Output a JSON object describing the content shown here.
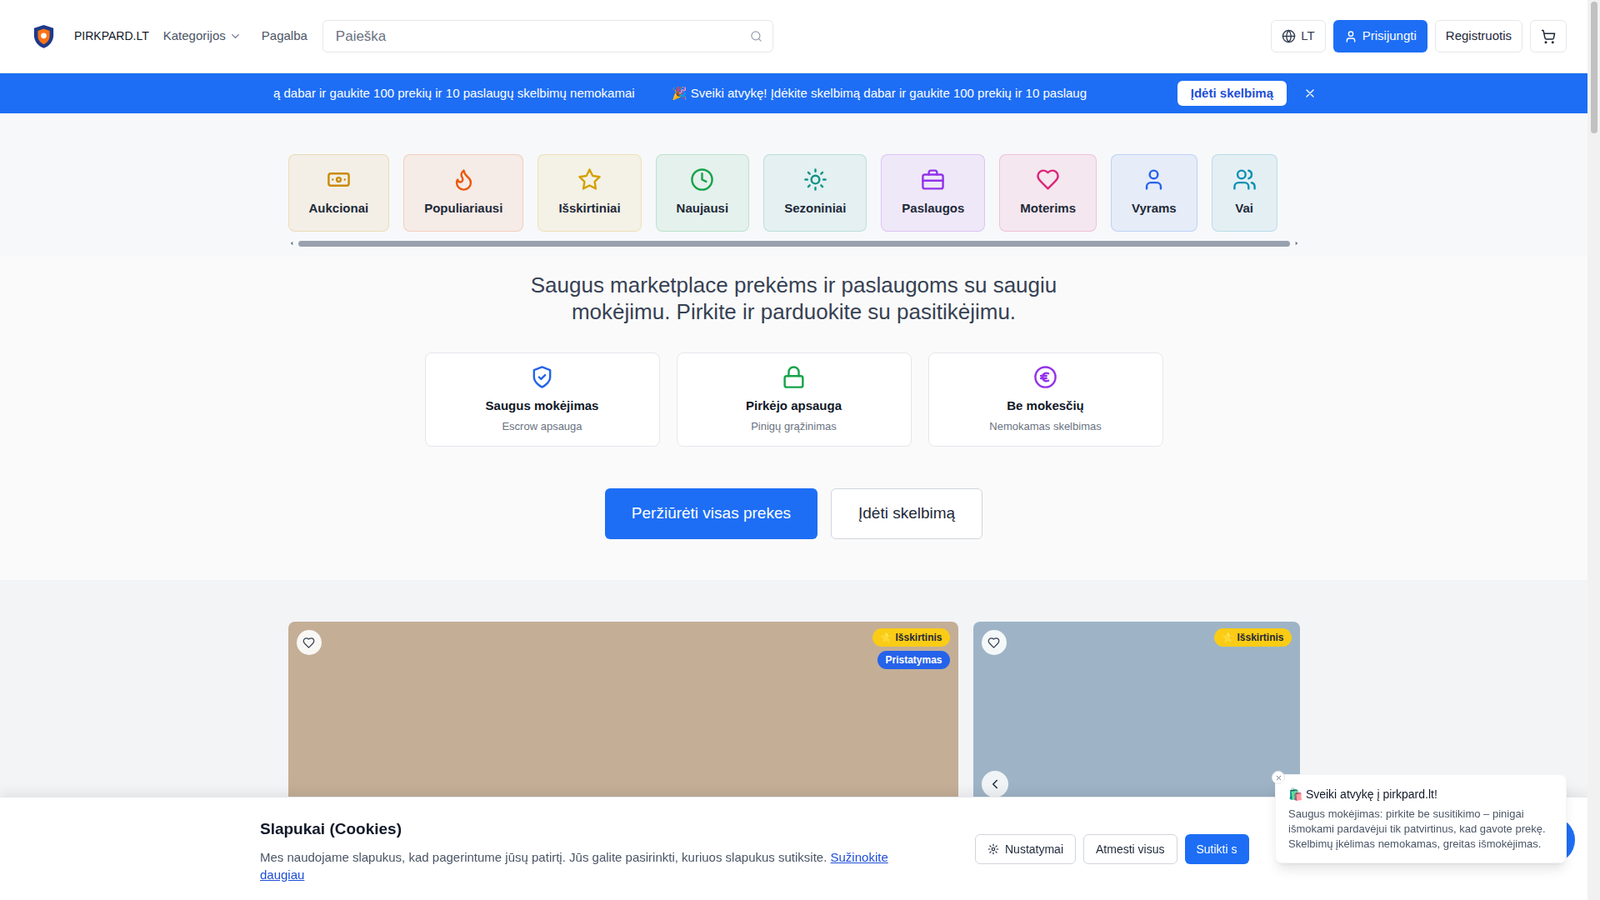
{
  "header": {
    "brand": "PIRKPARD.LT",
    "nav": [
      {
        "label": "Kategorijos",
        "kind": "dropdown",
        "expanded": false
      },
      {
        "label": "Pagalba",
        "kind": "link",
        "expanded": false
      }
    ],
    "search": {
      "placeholder": "Paieška"
    },
    "language": "LT",
    "login": "Prisijungti",
    "register": "Registruotis"
  },
  "banner": {
    "messages": [
      "ą dabar ir gaukite 100 prekių ir 10 paslaugų skelbimų nemokamai",
      "🎉 Sveiki atvykę! Įdėkite skelbimą dabar ir gaukite 100 prekių ir 10 paslaug"
    ],
    "cta": "Įdėti skelbimą"
  },
  "categories": [
    {
      "label": "Aukcionai",
      "color": "#ca8a04"
    },
    {
      "label": "Populiariausi",
      "color": "#ea580c"
    },
    {
      "label": "Išskirtiniai",
      "color": "#d4a106"
    },
    {
      "label": "Naujausi",
      "color": "#16a34a"
    },
    {
      "label": "Sezoniniai",
      "color": "#0d9488"
    },
    {
      "label": "Paslaugos",
      "color": "#9333ea"
    },
    {
      "label": "Moterims",
      "color": "#db2777"
    },
    {
      "label": "Vyrams",
      "color": "#2563eb"
    },
    {
      "label": "Vai",
      "color": "#0891b2"
    }
  ],
  "hero": {
    "tagline": "Saugus marketplace prekėms ir paslaugoms su saugiu mokėjimu. Pirkite ir parduokite su pasitikėjimu.",
    "features": [
      {
        "title": "Saugus mokėjimas",
        "subtitle": "Escrow apsauga",
        "color": "#2563eb"
      },
      {
        "title": "Pirkėjo apsauga",
        "subtitle": "Pinigų grąžinimas",
        "color": "#16a34a"
      },
      {
        "title": "Be mokesčių",
        "subtitle": "Nemokamas skelbimas",
        "color": "#9333ea"
      }
    ],
    "buttons": [
      {
        "label": "Peržiūrėti visas prekes",
        "kind": "primary"
      },
      {
        "label": "Įdėti skelbimą",
        "kind": "secondary"
      }
    ]
  },
  "listings": [
    {
      "favorite": false,
      "kind": "single",
      "badges": [
        {
          "label": "⭐ Išskirtinis",
          "color": "#facc15"
        },
        {
          "label": "Pristatymas",
          "color": "#2563eb"
        }
      ]
    },
    {
      "favorite": false,
      "kind": "gallery",
      "badges": [
        {
          "label": "⭐ Išskirtinis",
          "color": "#facc15"
        }
      ]
    }
  ],
  "cookies": {
    "title": "Slapukai (Cookies)",
    "text": "Mes naudojame slapukus, kad pagerintume jūsų patirtį. Jūs galite pasirinkti, kuriuos slapukus sutiksite.",
    "link": "Sužinokite daugiau",
    "buttons": [
      {
        "label": "Nustatymai",
        "kind": "settings"
      },
      {
        "label": "Atmesti visus",
        "kind": "secondary"
      },
      {
        "label": "Sutikti s",
        "kind": "primary"
      }
    ]
  },
  "toast": {
    "title": "🛍️ Sveiki atvykę į pirkpard.lt!",
    "text": "Saugus mokėjimas: pirkite be susitikimo – pinigai išmokami pardavėjui tik patvirtinus, kad gavote prekę. Skelbimų įkėlimas nemokamas, greitas išmokėjimas."
  }
}
